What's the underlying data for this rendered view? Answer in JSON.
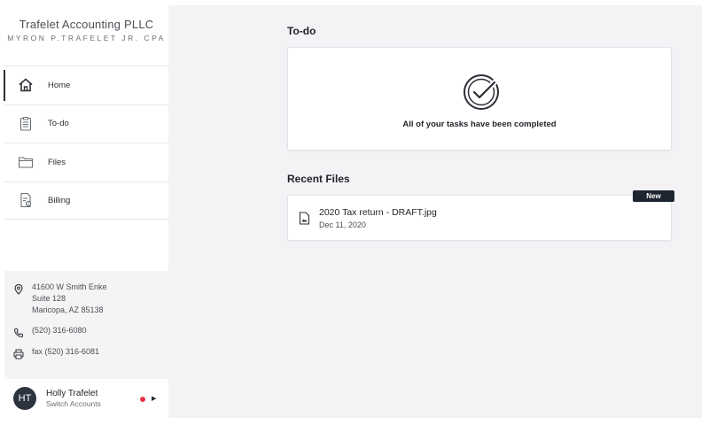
{
  "brand": {
    "name": "Trafelet Accounting PLLC",
    "subtitle": "MYRON P.TRAFELET JR. CPA"
  },
  "nav": {
    "items": [
      {
        "label": "Home",
        "icon": "home-icon",
        "active": true
      },
      {
        "label": "To-do",
        "icon": "clipboard-icon",
        "active": false
      },
      {
        "label": "Files",
        "icon": "folder-icon",
        "active": false
      },
      {
        "label": "Billing",
        "icon": "invoice-icon",
        "active": false
      }
    ]
  },
  "contact": {
    "address_line1": "41600 W Smith Enke",
    "address_line2": "Suite 128",
    "address_line3": "Maricopa, AZ 85138",
    "phone": "(520) 316-6080",
    "fax": "fax (520) 316-6081"
  },
  "account": {
    "initials": "HT",
    "name": "Holly Trafelet",
    "switch_label": "Switch Accounts",
    "notification_color": "#e8344a"
  },
  "todo": {
    "title": "To-do",
    "empty_message": "All of your tasks have been completed"
  },
  "recent_files": {
    "title": "Recent Files",
    "badge": "New",
    "items": [
      {
        "name": "2020 Tax return - DRAFT.jpg",
        "date": "Dec 11, 2020"
      }
    ]
  }
}
